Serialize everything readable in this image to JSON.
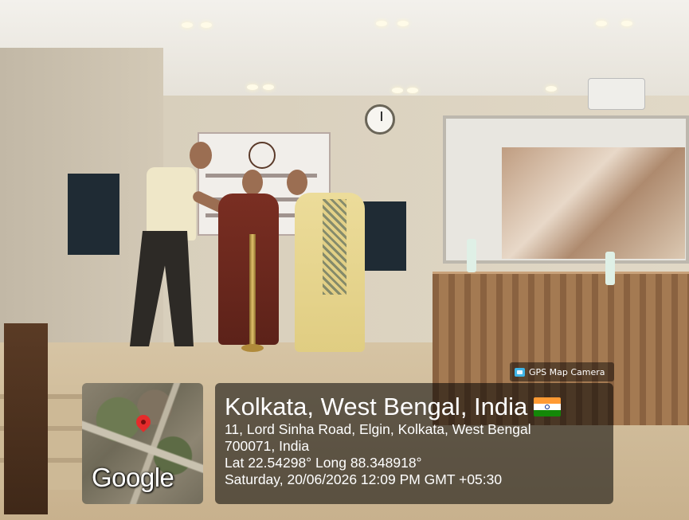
{
  "gps_camera": {
    "app_label": "GPS Map Camera",
    "app_icon": "gps-map-camera-icon",
    "map_brand": "Google",
    "pin_icon": "location-pin-icon",
    "location_title": "Kolkata, West Bengal, India",
    "flag_icon": "india-flag-icon",
    "address_line_1": "11, Lord Sinha Road, Elgin, Kolkata, West Bengal",
    "address_line_2": "700071, India",
    "coordinates": "Lat 22.54298° Long 88.348918°",
    "datetime": "Saturday, 20/06/2026 12:09 PM GMT +05:30"
  },
  "colors": {
    "overlay_background": "#000000",
    "pin": "#e52b2b",
    "flag_saffron": "#ff9a33",
    "flag_green": "#138808"
  }
}
